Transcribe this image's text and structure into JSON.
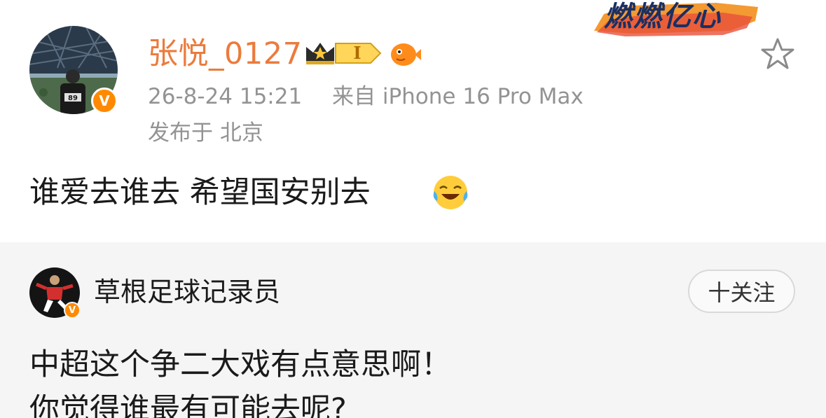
{
  "post": {
    "username": "张悦_0127",
    "level_badge": "I",
    "timestamp": "26-8-24 15:21",
    "source": "来自 iPhone 16 Pro Max",
    "location": "发布于 北京",
    "text": "谁爱去谁去 希望国安别去",
    "decor_text": "燃燃亿心",
    "verified_mark": "V",
    "icons": {
      "avatar": "avatar-stadium-fan",
      "verified": "verified-badge-icon",
      "crown": "crown-icon",
      "fish": "pufferfish-icon",
      "star": "star-icon",
      "emoji": "laughing-tears-emoji"
    }
  },
  "quote": {
    "username": "草根足球记录员",
    "follow_label": "十关注",
    "verified_mark": "V",
    "line1": "中超这个争二大戏有点意思啊！",
    "line2": "你觉得谁最有可能去呢?"
  },
  "colors": {
    "username": "#eb7b3c",
    "meta": "#939393",
    "verified": "#ff8a00",
    "quote_bg": "#f5f5f5",
    "text": "#1a1a1a"
  }
}
